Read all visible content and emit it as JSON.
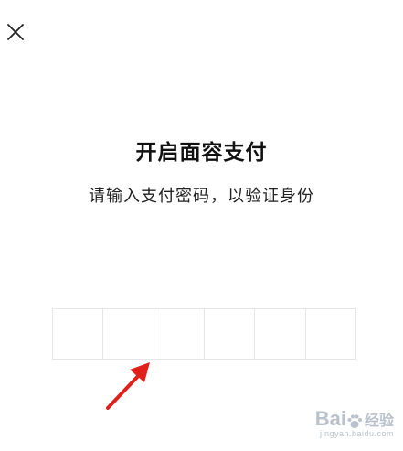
{
  "header": {
    "close_icon": "close-icon"
  },
  "main": {
    "title": "开启面容支付",
    "subtitle": "请输入支付密码，以验证身份",
    "pin_input": {
      "length": 6,
      "value": ""
    }
  },
  "annotation": {
    "arrow_icon": "red-arrow-icon",
    "arrow_color": "#e0201b"
  },
  "watermark": {
    "logo_left": "Bai",
    "logo_right": "经验",
    "url": "jingyan.baidu.com"
  }
}
